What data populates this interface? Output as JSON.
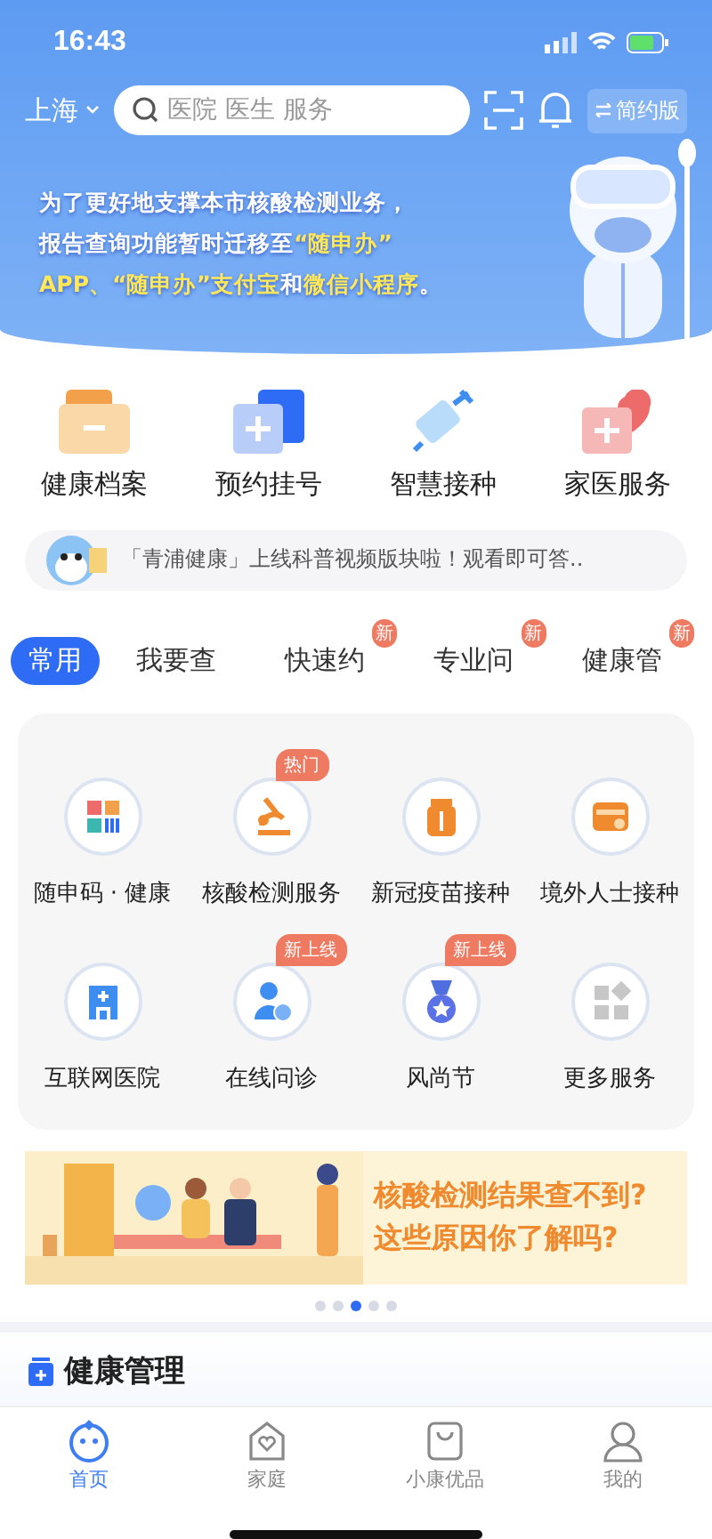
{
  "status_bar": {
    "time": "16:43"
  },
  "header": {
    "city": "上海",
    "search": {
      "placeholder": "医院 医生 服务"
    },
    "mode_button": "简约版"
  },
  "hero": {
    "lines": [
      [
        {
          "text": "为了更好地支撑本市核酸检测业务，",
          "highlight": false
        }
      ],
      [
        {
          "text": "报告查询功能暂时迁移至",
          "highlight": false
        },
        {
          "text": "“随申办”",
          "highlight": true
        }
      ],
      [
        {
          "text": "APP、“随申办”支付宝",
          "highlight": true
        },
        {
          "text": "和",
          "highlight": false
        },
        {
          "text": "微信小程序",
          "highlight": true
        },
        {
          "text": "。",
          "highlight": false
        }
      ]
    ]
  },
  "quick_services": [
    {
      "label": "健康档案",
      "kind": "folder"
    },
    {
      "label": "预约挂号",
      "kind": "plus-card"
    },
    {
      "label": "智慧接种",
      "kind": "syringe"
    },
    {
      "label": "家医服务",
      "kind": "medkit"
    }
  ],
  "notice": {
    "text": "「青浦健康」上线科普视频版块啦！观看即可答.."
  },
  "tabs": [
    {
      "label": "常用",
      "selected": true
    },
    {
      "label": "我要查",
      "selected": false
    },
    {
      "label": "快速约",
      "selected": false,
      "badge": "新"
    },
    {
      "label": "专业问",
      "selected": false,
      "badge": "新"
    },
    {
      "label": "健康管",
      "selected": false,
      "badge": "新"
    }
  ],
  "services": [
    {
      "label": "随申码 · 健康",
      "kind": "qr"
    },
    {
      "label": "核酸检测服务",
      "kind": "microscope",
      "badge": "热门"
    },
    {
      "label": "新冠疫苗接种",
      "kind": "bottle"
    },
    {
      "label": "境外人士接种",
      "kind": "card"
    },
    {
      "label": "互联网医院",
      "kind": "building"
    },
    {
      "label": "在线问诊",
      "kind": "doctor",
      "badge": "新上线"
    },
    {
      "label": "风尚节",
      "kind": "medal",
      "badge": "新上线"
    },
    {
      "label": "更多服务",
      "kind": "grid"
    }
  ],
  "promo": {
    "lines": [
      "核酸检测结果查不到?",
      "这些原因你了解吗?"
    ]
  },
  "carousel_dots": [
    {
      "selected": false
    },
    {
      "selected": false
    },
    {
      "selected": true
    },
    {
      "selected": false
    },
    {
      "selected": false
    }
  ],
  "section": {
    "title": "健康管理"
  },
  "bottom_nav": [
    {
      "label": "首页",
      "selected": true,
      "kind": "mascot"
    },
    {
      "label": "家庭",
      "selected": false,
      "kind": "house"
    },
    {
      "label": "小康优品",
      "selected": false,
      "kind": "bag"
    },
    {
      "label": "我的",
      "selected": false,
      "kind": "person"
    }
  ]
}
